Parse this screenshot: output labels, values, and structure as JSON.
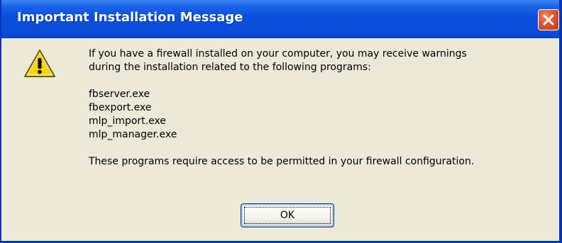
{
  "dialog": {
    "title": "Important Installation Message",
    "close_icon": "close-icon",
    "warning_icon": "warning-icon",
    "message": {
      "intro_line1": "If you have a firewall installed on your computer, you may receive warnings",
      "intro_line2": "during the installation related to the following programs:",
      "programs": [
        "fbserver.exe",
        "fbexport.exe",
        "mlp_import.exe",
        "mlp_manager.exe"
      ],
      "footer": "These programs require access to be permitted in your firewall configuration."
    },
    "ok_label": "OK"
  },
  "colors": {
    "titlebar": "#0a4fdc",
    "client_background": "#ece9d8",
    "close_button": "#e0532e",
    "warning_yellow": "#f7d51d"
  }
}
